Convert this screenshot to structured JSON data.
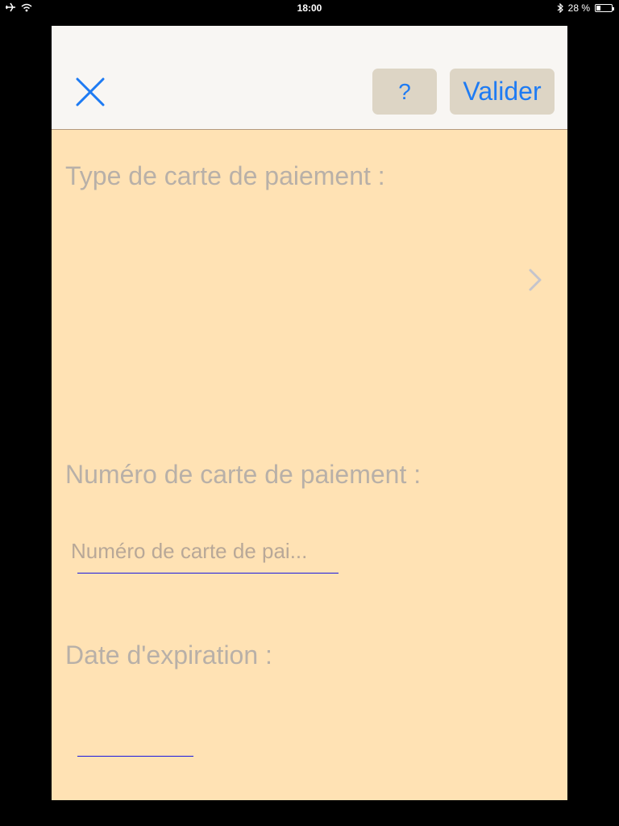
{
  "status_bar": {
    "time": "18:00",
    "battery_text": "28 %",
    "battery_level": 0.28
  },
  "navbar": {
    "close_icon": "close-icon",
    "help_label": "?",
    "validate_label": "Valider",
    "accent_color": "#1E7BF3"
  },
  "form": {
    "card_type_label": "Type de carte de paiement :",
    "card_number_label": "Numéro de carte de paiement :",
    "card_number_placeholder": "Numéro de carte de pai...",
    "card_number_value": "",
    "expiry_label": "Date d'expiration :",
    "expiry_value": "",
    "background_color": "#FFE2B4"
  }
}
